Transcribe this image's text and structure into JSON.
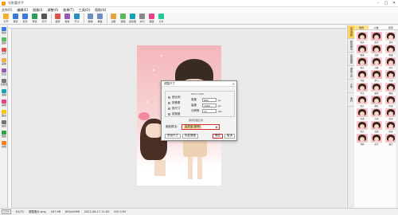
{
  "window": {
    "title": "光影魔术手"
  },
  "menu": [
    "文件(F)",
    "编辑(E)",
    "图像(I)",
    "调整(A)",
    "效果(T)",
    "工具(O)",
    "帮助(H)"
  ],
  "toolbar": [
    {
      "label": "打开",
      "color": "#f0b030"
    },
    {
      "label": "保存",
      "color": "#3b78d8"
    },
    {
      "label": "另存",
      "color": "#3b78d8"
    },
    {
      "label": "预览",
      "color": "#2a9d58"
    },
    {
      "label": "打印",
      "color": "#555555"
    },
    {
      "label": "旋转",
      "color": "#d9534f"
    },
    {
      "label": "裁剪",
      "color": "#9b59b6"
    },
    {
      "label": "尺寸",
      "color": "#2b8cbe"
    },
    {
      "label": "撤销",
      "color": "#6c8ebf"
    },
    {
      "label": "重做",
      "color": "#6c8ebf"
    },
    {
      "label": "边框",
      "color": "#e6a23c"
    },
    {
      "label": "拼图",
      "color": "#5cb85c"
    },
    {
      "label": "批处理",
      "color": "#17a2b8"
    },
    {
      "label": "水印",
      "color": "#888888"
    },
    {
      "label": "美容",
      "color": "#e83e8c"
    },
    {
      "label": "分享",
      "color": "#20c997"
    }
  ],
  "left_tools": [
    {
      "label": "裁剪",
      "color": "#3b78d8"
    },
    {
      "label": "旋转",
      "color": "#5cb85c"
    },
    {
      "label": "文字",
      "color": "#d9534f"
    },
    {
      "label": "画笔",
      "color": "#f0ad4e"
    },
    {
      "label": "标注",
      "color": "#9b59b6"
    },
    {
      "label": "马赛克",
      "color": "#777777"
    },
    {
      "label": "消除",
      "color": "#17a2b8"
    },
    {
      "label": "涂鸦",
      "color": "#e83e8c"
    },
    {
      "label": "美白",
      "color": "#ffc107"
    },
    {
      "label": "祛痘",
      "color": "#6c757d"
    },
    {
      "label": "瘦脸",
      "color": "#28a745"
    },
    {
      "label": "边框",
      "color": "#fd7e14"
    }
  ],
  "dialog": {
    "title": "调整尺寸",
    "close": "✕",
    "radios": [
      "按比例",
      "按像素",
      "按尺寸",
      "按宽度"
    ],
    "fields": [
      {
        "label": "宽度",
        "value": "800",
        "unit": "px"
      },
      {
        "label": "高度",
        "value": "1066",
        "unit": "px"
      },
      {
        "label": "分辨率",
        "value": "72",
        "unit": "dpi"
      }
    ],
    "top_value": "800×1066",
    "note": "保持原图比例",
    "select_label": "缩放算法:",
    "select_value": "高质量(推荐)",
    "buttons": [
      "预设尺寸",
      "恢复原图",
      "确定",
      "取消"
    ]
  },
  "right_vtabs": [
    "基本调整",
    "数码暗房",
    "边框图层",
    "便捷工具",
    "文字",
    "素材"
  ],
  "right_panel": {
    "tabs": [
      "场景",
      "人像",
      "风景"
    ],
    "thumbs": [
      {
        "label": "唯美",
        "bg": "#f8c9cf"
      },
      {
        "label": "甜美",
        "bg": "#f5b8c4"
      },
      {
        "label": "清新",
        "bg": "#f9d6da"
      },
      {
        "label": "糖果",
        "bg": "#f7bfc9"
      },
      {
        "label": "温暖",
        "bg": "#f3c4c8"
      },
      {
        "label": "粉嫩",
        "bg": "#fad0d6"
      },
      {
        "label": "柔光",
        "bg": "#f5c0c6"
      },
      {
        "label": "淡雅",
        "bg": "#f8ccd2"
      },
      {
        "label": "日系",
        "bg": "#f6c4cb"
      },
      {
        "label": "可爱",
        "bg": "#f9d2d8"
      },
      {
        "label": "梦幻",
        "bg": "#f4bac2"
      },
      {
        "label": "少女",
        "bg": "#f7c8ce"
      },
      {
        "label": "复古",
        "bg": "#f2c0c5"
      },
      {
        "label": "暖阳",
        "bg": "#f8cdd3"
      },
      {
        "label": "蜜桃",
        "bg": "#f6c2c9"
      },
      {
        "label": "胶片",
        "bg": "#f9d0d5"
      },
      {
        "label": "樱花",
        "bg": "#f4bfc6"
      },
      {
        "label": "奶油",
        "bg": "#f7cacf"
      },
      {
        "label": "浪漫",
        "bg": "#f5c3ca"
      },
      {
        "label": "冷调",
        "bg": "#f8cfd4"
      },
      {
        "label": "蓝调",
        "bg": "#f4c1c7"
      },
      {
        "label": "黑白",
        "bg": "#f7c7cd"
      },
      {
        "label": "清透",
        "bg": "#f6c6cc"
      },
      {
        "label": "质感",
        "bg": "#f9cdd3"
      },
      {
        "label": "经典",
        "bg": "#f3bec5"
      },
      {
        "label": "星光",
        "bg": "#f8c8ce"
      },
      {
        "label": "魅力",
        "bg": "#f5c4ca"
      }
    ]
  },
  "status": {
    "zoom": "23%",
    "size": "61/72",
    "filename": "调整图片.png",
    "filesize": "167 KB",
    "dimensions": "800x1066",
    "datetime": "2022-08-17 11:00",
    "info": "ISO 0 EV"
  },
  "colors": {
    "accent": "#d42b2b",
    "highlight": "#ffd25a"
  }
}
